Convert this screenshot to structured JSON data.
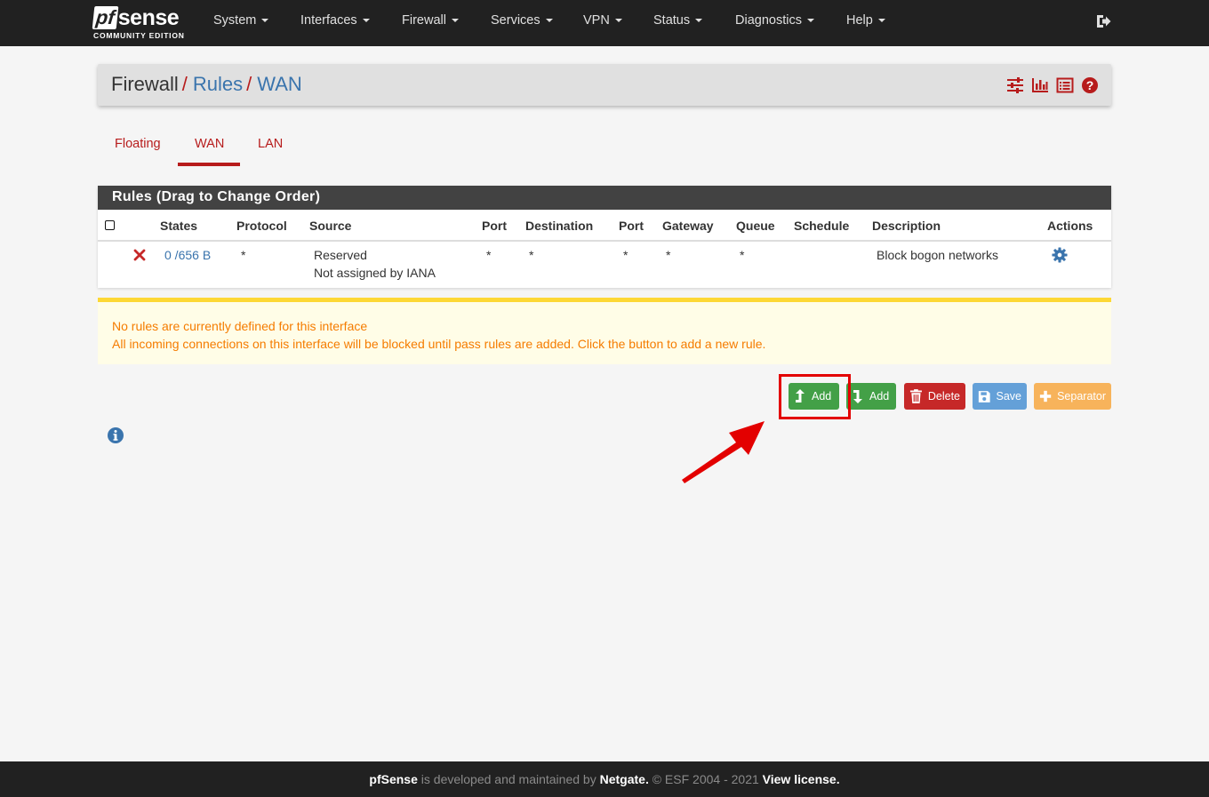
{
  "brand": {
    "logo_pf": "pf",
    "logo_sense": "sense",
    "edition": "COMMUNITY EDITION"
  },
  "nav": {
    "items": [
      {
        "label": "System"
      },
      {
        "label": "Interfaces"
      },
      {
        "label": "Firewall"
      },
      {
        "label": "Services"
      },
      {
        "label": "VPN"
      },
      {
        "label": "Status"
      },
      {
        "label": "Diagnostics"
      },
      {
        "label": "Help"
      }
    ],
    "logout_icon": "sign-out-icon"
  },
  "breadcrumb": {
    "first": "Firewall",
    "sep1": "/",
    "second": "Rules",
    "sep2": "/",
    "third": "WAN"
  },
  "header_icons": [
    "sliders-icon",
    "bar-chart-icon",
    "list-icon",
    "question-circle-icon"
  ],
  "tabs": [
    {
      "label": "Floating"
    },
    {
      "label": "WAN",
      "active": true
    },
    {
      "label": "LAN"
    }
  ],
  "rules_panel": {
    "title": "Rules (Drag to Change Order)",
    "columns": [
      "States",
      "Protocol",
      "Source",
      "Port",
      "Destination",
      "Port",
      "Gateway",
      "Queue",
      "Schedule",
      "Description",
      "Actions"
    ],
    "row": {
      "status_icon": "block-x-icon",
      "states": "0 /656 B",
      "protocol": "*",
      "source_line1": "Reserved",
      "source_line2": "Not assigned by IANA",
      "source_port": "*",
      "destination": "*",
      "dest_port": "*",
      "gateway": "*",
      "queue": "*",
      "schedule": "",
      "description": "Block bogon networks",
      "action_icon": "gear-icon"
    }
  },
  "alert": {
    "line1": "No rules are currently defined for this interface",
    "line2": "All incoming connections on this interface will be blocked until pass rules are added. Click the button to add a new rule."
  },
  "buttons": {
    "add_top": "Add",
    "add_bottom": "Add",
    "delete": "Delete",
    "save": "Save",
    "separator": "Separator"
  },
  "colors": {
    "navbar": "#212121",
    "accent_red": "#b71c1c",
    "link_blue": "#3a74ad",
    "green": "#43a047",
    "warning_text": "#f57c00",
    "warning_border": "#fdd835",
    "highlight": "#e30000"
  },
  "footer": {
    "brand": "pfSense",
    "text1": " is developed and maintained by ",
    "company": "Netgate.",
    "text2": " © ESF 2004 - 2021 ",
    "license": "View license."
  }
}
